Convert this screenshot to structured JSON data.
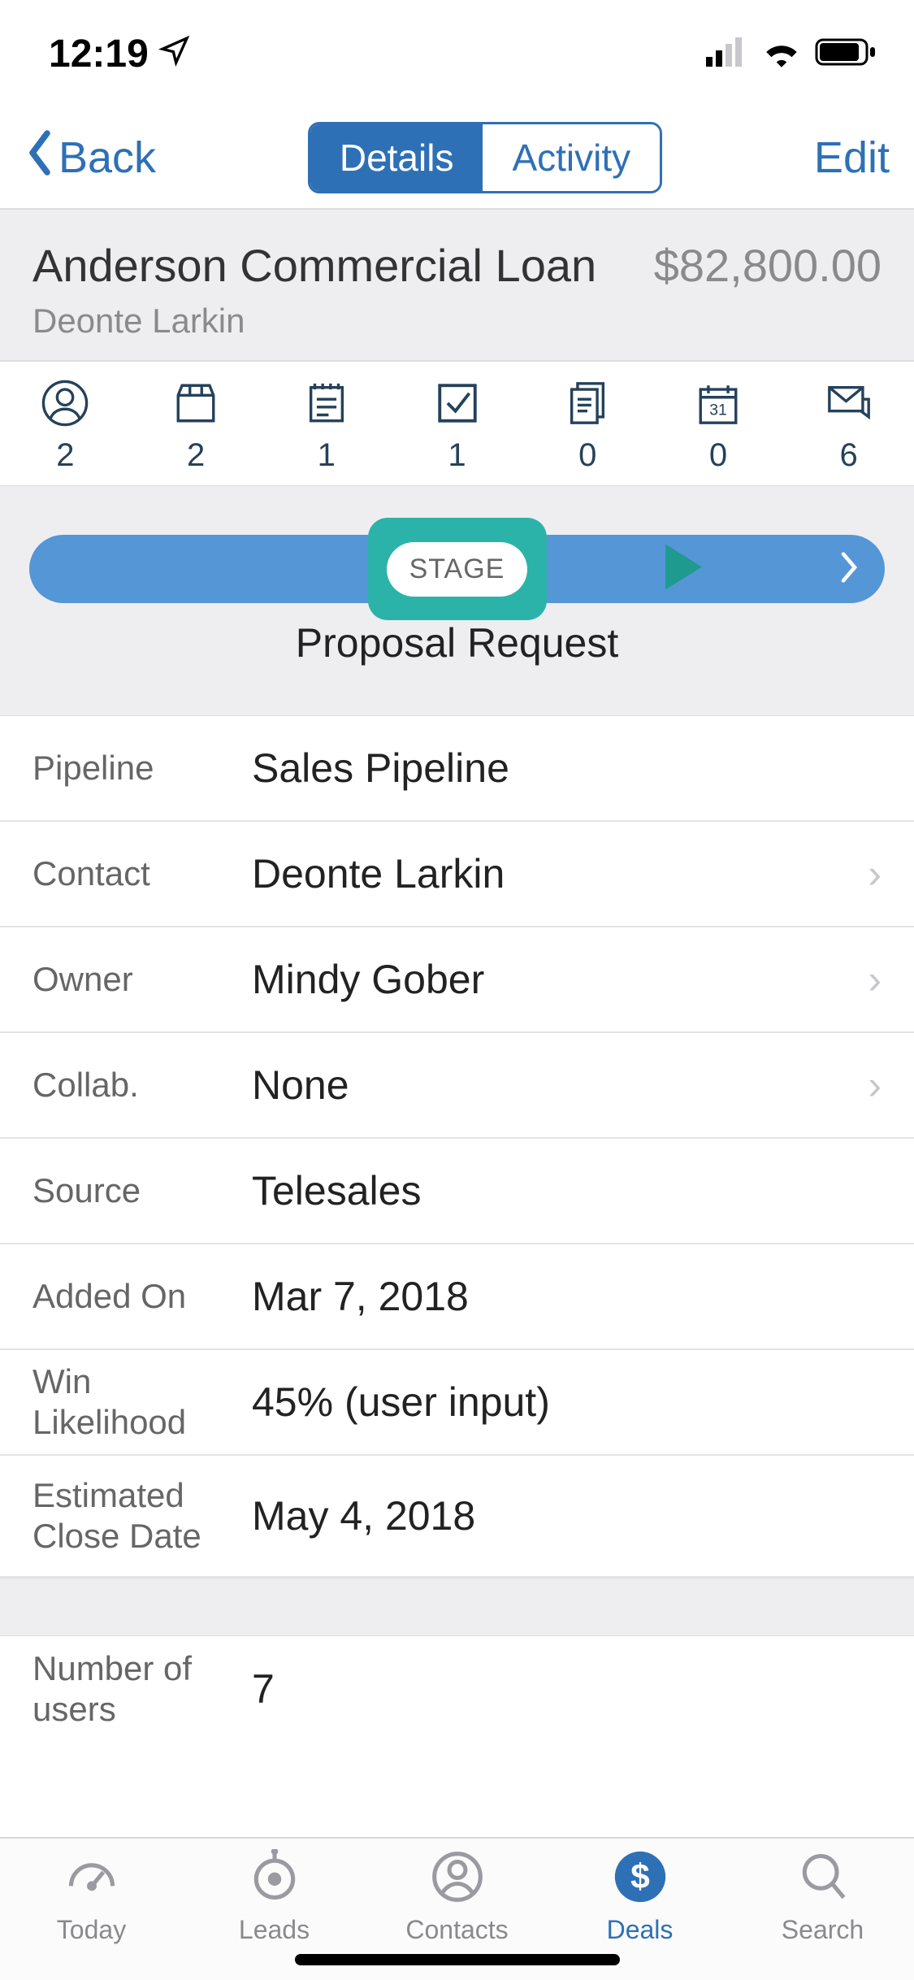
{
  "status": {
    "time": "12:19"
  },
  "nav": {
    "back": "Back",
    "tab_details": "Details",
    "tab_activity": "Activity",
    "edit": "Edit"
  },
  "deal": {
    "title": "Anderson Commercial Loan",
    "amount": "$82,800.00",
    "contact_subtitle": "Deonte Larkin"
  },
  "counts": {
    "people": "2",
    "products": "2",
    "notes": "1",
    "tasks": "1",
    "files": "0",
    "calendar": "0",
    "mail": "6"
  },
  "stage": {
    "pill": "STAGE",
    "name": "Proposal Request"
  },
  "fields": {
    "pipeline": {
      "label": "Pipeline",
      "value": "Sales Pipeline"
    },
    "contact": {
      "label": "Contact",
      "value": "Deonte Larkin"
    },
    "owner": {
      "label": "Owner",
      "value": "Mindy Gober"
    },
    "collab": {
      "label": "Collab.",
      "value": "None"
    },
    "source": {
      "label": "Source",
      "value": "Telesales"
    },
    "added": {
      "label": "Added On",
      "value": "Mar 7, 2018"
    },
    "win": {
      "label": "Win Likelihood",
      "value": "45% (user input)"
    },
    "close": {
      "label": "Estimated Close Date",
      "value": "May 4, 2018"
    },
    "users": {
      "label": "Number of users",
      "value": "7"
    }
  },
  "tabs": {
    "today": "Today",
    "leads": "Leads",
    "contacts": "Contacts",
    "deals": "Deals",
    "search": "Search"
  }
}
